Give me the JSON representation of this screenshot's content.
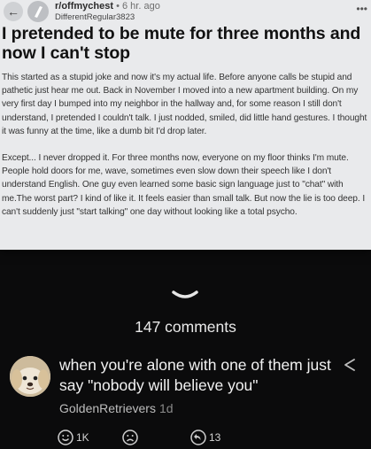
{
  "post": {
    "subreddit": "r/offmychest",
    "time": "• 6 hr. ago",
    "author": "DifferentRegular3823",
    "title": "I pretended to be mute for three months and now I can't stop",
    "paragraphs": [
      "This started as a stupid joke and now it's my actual life. Before anyone calls be stupid and pathetic just hear me out. Back in November I moved into a new apartment building. On my very first day I bumped into my neighbor in the hallway and, for some reason I still don't understand, I pretended I couldn't talk. I just nodded, smiled, did little hand gestures. I thought it was funny at the time, like a dumb bit I'd drop later.",
      "Except... I never dropped it. For three months now, everyone on my floor thinks I'm mute. People hold doors for me, wave, sometimes even slow down their speech like I don't understand English. One guy even learned some basic sign language just to \"chat\" with me.The worst part? I kind of like it. It feels easier than small talk. But now the lie is too deep. I can't suddenly just \"start talking\" one day without looking like a total psycho."
    ]
  },
  "comments_count": "147 comments",
  "comment": {
    "text": "when you're alone with one of them just say \"nobody will believe you\"",
    "username": "GoldenRetrievers",
    "age": "1d",
    "reactions": [
      {
        "icon": "smile-icon",
        "count": "1K"
      },
      {
        "icon": "sad-face-icon",
        "count": ""
      },
      {
        "icon": "reply-icon",
        "count": "13"
      }
    ]
  },
  "icons": {
    "back": "back-arrow-icon",
    "more": "more-dots-icon",
    "chevron": "chevron-down-icon",
    "share": "share-icon"
  }
}
